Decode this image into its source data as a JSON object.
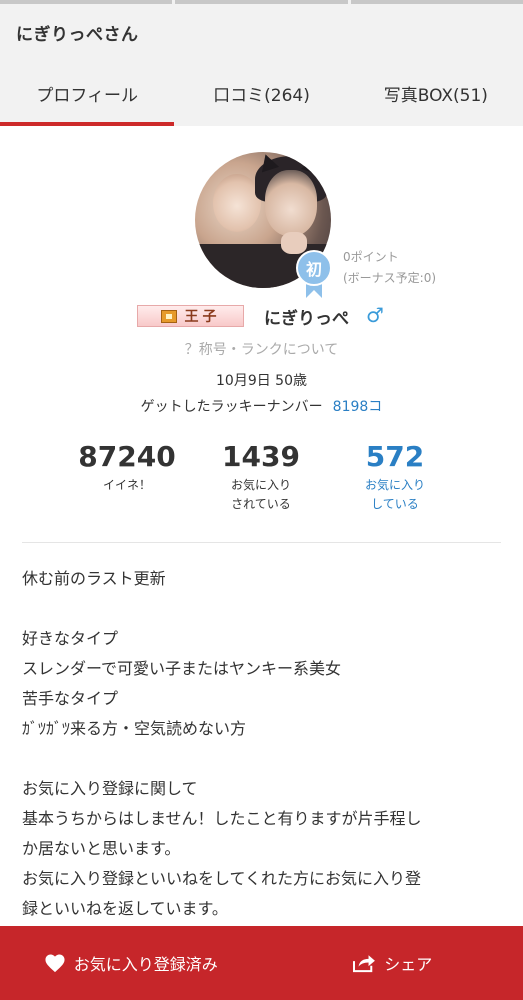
{
  "header": {
    "title": "にぎりっぺさん"
  },
  "tabs": [
    {
      "label": "プロフィール",
      "active": true
    },
    {
      "label": "口コミ(264)",
      "active": false
    },
    {
      "label": "写真BOX(51)",
      "active": false
    }
  ],
  "profile": {
    "badge_label": "初",
    "points": "0ポイント",
    "points_note": "(ボーナス予定:0)",
    "rank_title": "王子",
    "nickname": "にぎりっぺ",
    "gender_symbol": "♂",
    "rank_link": "？称号・ランクについて",
    "birth_age": "10月9日 50歳",
    "lucky_label": "ゲットしたラッキーナンバー",
    "lucky_value": "8198コ"
  },
  "stats": [
    {
      "value": "87240",
      "label_line1": "イイネ！",
      "label_line2": ""
    },
    {
      "value": "1439",
      "label_line1": "お気に入り",
      "label_line2": "されている"
    },
    {
      "value": "572",
      "label_line1": "お気に入り",
      "label_line2": "している"
    }
  ],
  "bio": [
    "休む前のラスト更新",
    "",
    "好きなタイプ",
    "スレンダーで可愛い子またはヤンキー系美女",
    "苦手なタイプ",
    "ｶﾞﾂｶﾞﾂ来る方・空気読めない方",
    "",
    "お気に入り登録に関して",
    "基本うちからはしません！したこと有りますが片手程し",
    "か居ないと思います。",
    "お気に入り登録といいねをしてくれた方にお気に入り登",
    "録といいねを返しています。"
  ],
  "actions": {
    "favorite_label": "お気に入り登録済み",
    "share_label": "シェア"
  },
  "colors": {
    "accent": "#c6262a",
    "link": "#2a7fc4",
    "badge": "#8ec0ea",
    "male": "#3a9bd9"
  }
}
